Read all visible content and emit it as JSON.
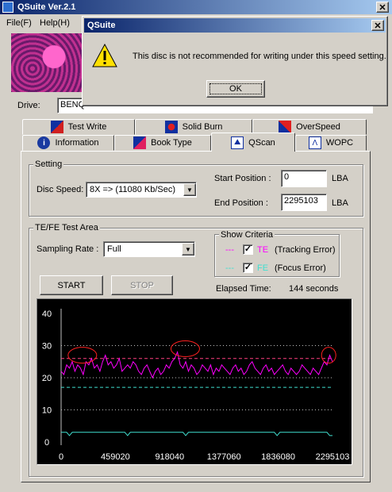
{
  "window": {
    "title": "QSuite Ver.2.1"
  },
  "menu": {
    "file": "File(F)",
    "help": "Help(H)"
  },
  "drive": {
    "label": "Drive:",
    "value": "BENQ"
  },
  "tabs_row1": [
    {
      "label": "Test Write",
      "icon": "test-write-icon"
    },
    {
      "label": "Solid Burn",
      "icon": "solid-burn-icon"
    },
    {
      "label": "OverSpeed",
      "icon": "overspeed-icon"
    }
  ],
  "tabs_row2": [
    {
      "label": "Information",
      "icon": "info-icon"
    },
    {
      "label": "Book Type",
      "icon": "book-type-icon"
    },
    {
      "label": "QScan",
      "icon": "qscan-icon",
      "active": true
    },
    {
      "label": "WOPC",
      "icon": "wopc-icon"
    }
  ],
  "setting": {
    "group_label": "Setting",
    "disc_speed_label": "Disc Speed:",
    "disc_speed_value": "8X => (11080 Kb/Sec)",
    "start_label": "Start Position :",
    "start_value": "0",
    "end_label": "End Position :",
    "end_value": "2295103",
    "unit": "LBA"
  },
  "test_area": {
    "group_label": "TE/FE Test Area",
    "sampling_label": "Sampling Rate :",
    "sampling_value": "Full",
    "criteria_label": "Show Criteria",
    "te_dash": "---",
    "te_code": "TE",
    "te_desc": "(Tracking Error)",
    "fe_dash": "---",
    "fe_code": "FE",
    "fe_desc": "(Focus Error)",
    "start_button": "START",
    "stop_button": "STOP",
    "elapsed_label": "Elapsed Time:",
    "elapsed_value": "144 seconds"
  },
  "dialog": {
    "title": "QSuite",
    "message": "This disc is not recommended for writing under this speed setting.",
    "ok": "OK"
  },
  "colors": {
    "te": "#ff00ff",
    "fe": "#40e0d0",
    "criteria_te": "#ff4080",
    "criteria_fe": "#40e0d0",
    "marker": "#ff2020"
  },
  "chart_data": {
    "type": "line",
    "xlim": [
      0,
      2295103
    ],
    "ylim": [
      0,
      40
    ],
    "x_ticks": [
      "0",
      "459020",
      "918040",
      "1377060",
      "1836080",
      "2295103"
    ],
    "y_ticks": [
      "40",
      "30",
      "20",
      "10",
      "0"
    ],
    "grid": "dotted horizontal",
    "criteria": {
      "te": 26,
      "fe": 17
    },
    "series": [
      {
        "name": "TE",
        "color": "#ff00ff",
        "values": [
          22,
          21,
          24,
          23,
          25,
          22,
          24,
          23,
          21,
          25,
          24,
          26,
          23,
          24,
          22,
          25,
          27,
          24,
          25,
          23,
          24,
          26,
          22,
          23,
          24,
          23,
          25,
          24,
          22,
          21,
          23,
          24,
          22,
          20,
          22,
          23,
          21,
          22,
          24,
          23,
          25,
          26,
          28,
          24,
          23,
          25,
          22,
          24,
          23,
          21,
          22,
          24,
          23,
          22,
          24,
          21,
          23,
          22,
          24,
          23,
          22,
          21,
          23,
          24,
          22,
          23,
          21,
          22,
          24,
          25,
          23,
          22,
          21,
          23,
          24,
          22,
          23,
          21,
          22,
          23,
          24,
          22,
          21,
          23,
          22,
          21,
          22,
          24,
          23,
          22,
          21,
          23,
          22,
          21,
          23,
          25,
          24,
          27,
          25
        ]
      },
      {
        "name": "FE",
        "color": "#40e0d0",
        "values": [
          3,
          3,
          3,
          2,
          3,
          3,
          3,
          3,
          3,
          3,
          3,
          3,
          3,
          3,
          3,
          3,
          3,
          3,
          3,
          3,
          3,
          3,
          3,
          3,
          2,
          3,
          3,
          3,
          3,
          3,
          3,
          3,
          3,
          3,
          3,
          3,
          3,
          3,
          3,
          3,
          3,
          3,
          3,
          3,
          3,
          2,
          3,
          3,
          3,
          3,
          3,
          3,
          3,
          3,
          3,
          3,
          3,
          3,
          3,
          3,
          3,
          3,
          3,
          3,
          3,
          3,
          3,
          3,
          3,
          3,
          3,
          3,
          3,
          3,
          3,
          3,
          3,
          3,
          2,
          3,
          3,
          3,
          3,
          3,
          3,
          3,
          3,
          3,
          3,
          3,
          3,
          3,
          3,
          3,
          3,
          3,
          3,
          2,
          2
        ]
      }
    ],
    "annotations": [
      "circled peaks near 180000, 1050000, 2290000"
    ]
  }
}
